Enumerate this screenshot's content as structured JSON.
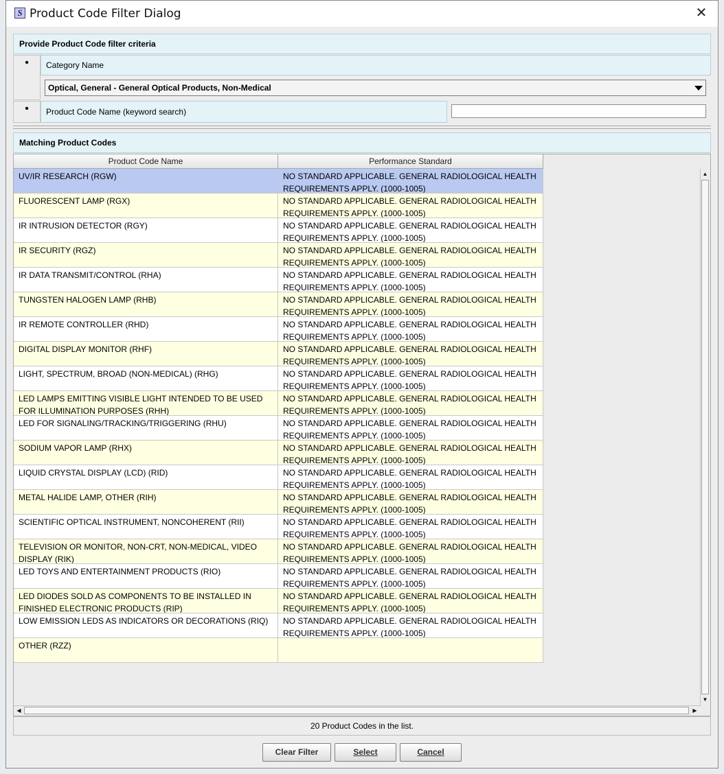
{
  "window": {
    "title": "Product Code Filter Dialog",
    "icon_letter": "S"
  },
  "criteria": {
    "header": "Provide Product Code filter criteria",
    "bullet": "•",
    "category_label": "Category Name",
    "category_value": "Optical, General - General Optical Products, Non-Medical",
    "keyword_label": "Product Code Name (keyword search)",
    "keyword_value": ""
  },
  "results": {
    "header": "Matching Product Codes",
    "columns": [
      "Product Code Name",
      "Performance Standard"
    ],
    "rows": [
      {
        "name": "UV/IR RESEARCH (RGW)",
        "standard": "NO STANDARD APPLICABLE. GENERAL RADIOLOGICAL HEALTH REQUIREMENTS APPLY. (1000-1005)"
      },
      {
        "name": "FLUORESCENT LAMP (RGX)",
        "standard": "NO STANDARD APPLICABLE. GENERAL RADIOLOGICAL HEALTH REQUIREMENTS APPLY. (1000-1005)"
      },
      {
        "name": "IR INTRUSION DETECTOR (RGY)",
        "standard": "NO STANDARD APPLICABLE. GENERAL RADIOLOGICAL HEALTH REQUIREMENTS APPLY. (1000-1005)"
      },
      {
        "name": "IR SECURITY (RGZ)",
        "standard": "NO STANDARD APPLICABLE. GENERAL RADIOLOGICAL HEALTH REQUIREMENTS APPLY. (1000-1005)"
      },
      {
        "name": "IR DATA TRANSMIT/CONTROL (RHA)",
        "standard": "NO STANDARD APPLICABLE. GENERAL RADIOLOGICAL HEALTH REQUIREMENTS APPLY. (1000-1005)"
      },
      {
        "name": "TUNGSTEN HALOGEN LAMP (RHB)",
        "standard": "NO STANDARD APPLICABLE. GENERAL RADIOLOGICAL HEALTH REQUIREMENTS APPLY. (1000-1005)"
      },
      {
        "name": "IR REMOTE CONTROLLER (RHD)",
        "standard": "NO STANDARD APPLICABLE. GENERAL RADIOLOGICAL HEALTH REQUIREMENTS APPLY. (1000-1005)"
      },
      {
        "name": "DIGITAL DISPLAY MONITOR (RHF)",
        "standard": "NO STANDARD APPLICABLE. GENERAL RADIOLOGICAL HEALTH REQUIREMENTS APPLY. (1000-1005)"
      },
      {
        "name": "LIGHT, SPECTRUM, BROAD (NON-MEDICAL) (RHG)",
        "standard": "NO STANDARD APPLICABLE. GENERAL RADIOLOGICAL HEALTH REQUIREMENTS APPLY. (1000-1005)"
      },
      {
        "name": "LED LAMPS EMITTING VISIBLE LIGHT INTENDED TO BE USED FOR ILLUMINATION PURPOSES (RHH)",
        "standard": "NO STANDARD APPLICABLE. GENERAL RADIOLOGICAL HEALTH REQUIREMENTS APPLY. (1000-1005)"
      },
      {
        "name": "LED FOR SIGNALING/TRACKING/TRIGGERING (RHU)",
        "standard": "NO STANDARD APPLICABLE. GENERAL RADIOLOGICAL HEALTH REQUIREMENTS APPLY. (1000-1005)"
      },
      {
        "name": "SODIUM VAPOR LAMP (RHX)",
        "standard": "NO STANDARD APPLICABLE. GENERAL RADIOLOGICAL HEALTH REQUIREMENTS APPLY. (1000-1005)"
      },
      {
        "name": "LIQUID CRYSTAL DISPLAY (LCD) (RID)",
        "standard": "NO STANDARD APPLICABLE. GENERAL RADIOLOGICAL HEALTH REQUIREMENTS APPLY. (1000-1005)"
      },
      {
        "name": "METAL HALIDE LAMP, OTHER (RIH)",
        "standard": "NO STANDARD APPLICABLE. GENERAL RADIOLOGICAL HEALTH REQUIREMENTS APPLY. (1000-1005)"
      },
      {
        "name": "SCIENTIFIC OPTICAL INSTRUMENT, NONCOHERENT (RII)",
        "standard": "NO STANDARD APPLICABLE. GENERAL RADIOLOGICAL HEALTH REQUIREMENTS APPLY. (1000-1005)"
      },
      {
        "name": "TELEVISION OR MONITOR, NON-CRT, NON-MEDICAL, VIDEO DISPLAY (RIK)",
        "standard": "NO STANDARD APPLICABLE. GENERAL RADIOLOGICAL HEALTH REQUIREMENTS APPLY. (1000-1005)"
      },
      {
        "name": "LED TOYS AND ENTERTAINMENT PRODUCTS (RIO)",
        "standard": "NO STANDARD APPLICABLE. GENERAL RADIOLOGICAL HEALTH REQUIREMENTS APPLY. (1000-1005)"
      },
      {
        "name": "LED DIODES SOLD AS COMPONENTS TO BE INSTALLED IN FINISHED ELECTRONIC PRODUCTS (RIP)",
        "standard": "NO STANDARD APPLICABLE. GENERAL RADIOLOGICAL HEALTH REQUIREMENTS APPLY. (1000-1005)"
      },
      {
        "name": "LOW EMISSION LEDS AS INDICATORS OR DECORATIONS (RIQ)",
        "standard": "NO STANDARD APPLICABLE. GENERAL RADIOLOGICAL HEALTH REQUIREMENTS APPLY. (1000-1005)"
      },
      {
        "name": "OTHER (RZZ)",
        "standard": ""
      }
    ],
    "selected_index": 0,
    "status": "20 Product Codes in the list."
  },
  "buttons": {
    "clear_filter": "Clear Filter",
    "select": "Select",
    "cancel": "Cancel"
  },
  "colors": {
    "header_bg": "#e3f3f7",
    "row_odd": "#ffffe2",
    "row_even": "#ffffff",
    "row_selected": "#b9c9f2"
  }
}
